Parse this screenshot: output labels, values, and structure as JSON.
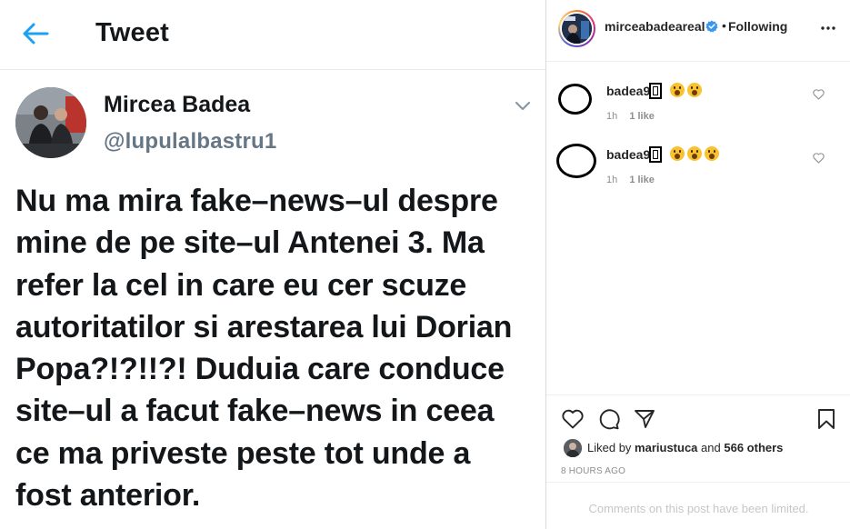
{
  "tweet": {
    "title": "Tweet",
    "name": "Mircea Badea",
    "handle": "@lupulalbastru1",
    "text": "Nu ma mira fake–news–ul despre\nmine de pe site–ul Antenei 3. Ma\nrefer la cel in care eu cer scuze\nautoritatilor si arestarea lui Dorian\nPopa?!?!!?! Duduia care conduce\nsite–ul a facut fake–news in ceea\nce ma priveste peste tot unde a\nfost anterior.",
    "accent_color": "#1da1f2"
  },
  "instagram": {
    "username": "mirceabadeareal",
    "separator": "•",
    "follow_status": "Following",
    "comments": [
      {
        "user": "badea9",
        "emojis": [
          "astonished-face",
          "astonished-face"
        ],
        "time": "1h",
        "likes": "1 like"
      },
      {
        "user": "badea9",
        "emojis": [
          "astonished-face",
          "astonished-face",
          "astonished-face"
        ],
        "time": "1h",
        "likes": "1 like"
      }
    ],
    "liked_by_prefix": "Liked by",
    "liked_by_user": "mariustuca",
    "liked_by_conjunction": "and",
    "liked_by_others": "566 others",
    "time_ago": "8 HOURS AGO",
    "comments_limited": "Comments on this post have been limited.",
    "icons": [
      "heart-icon",
      "comment-icon",
      "share-icon",
      "bookmark-icon",
      "more-icon",
      "verified-icon"
    ]
  }
}
